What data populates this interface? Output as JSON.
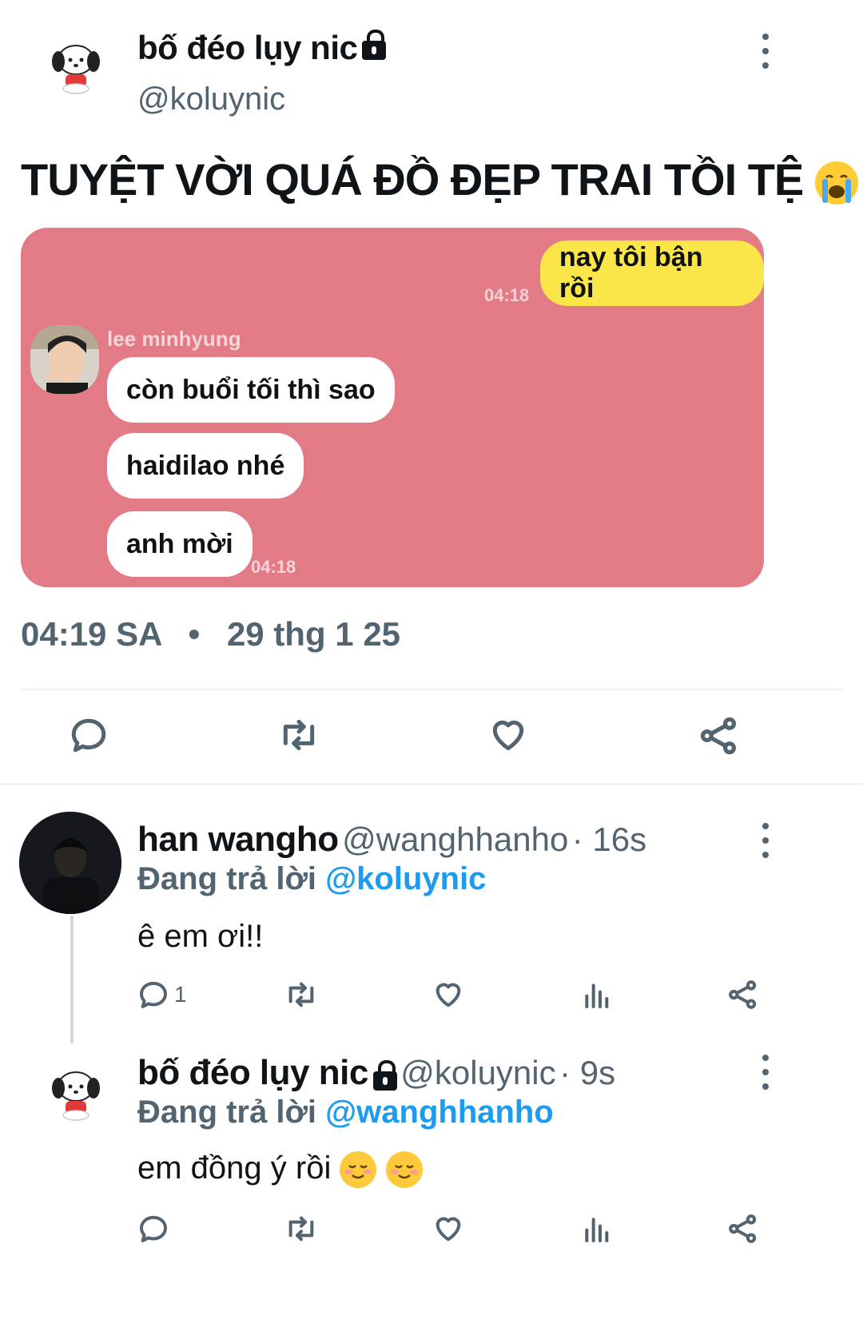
{
  "tweet": {
    "author_name": "bố đéo lụy nic",
    "author_handle": "@koluynic",
    "text": "TUYỆT VỜI QUÁ ĐỒ ĐẸP TRAI TỒI TỆ",
    "emoji": "loudly-crying-face",
    "time": "04:19 SA",
    "dot": "•",
    "date": "29 thg 1 25"
  },
  "chat": {
    "outgoing": {
      "text": "nay tôi bận rồi",
      "time": "04:18"
    },
    "sender_name": "lee minhyung",
    "incoming": [
      {
        "text": "còn buổi tối thì sao"
      },
      {
        "text": "haidilao nhé"
      },
      {
        "text": "anh mời"
      }
    ],
    "incoming_time": "04:18"
  },
  "colors": {
    "chat_bg": "#e27b85",
    "accent": "#1d9bf0",
    "muted": "#536471",
    "outgoing_bubble": "#fbe64a"
  },
  "replies": [
    {
      "name": "han wangho",
      "handle": "@wanghhanho",
      "age": "· 16s",
      "replying_prefix": "Đang trả lời",
      "replying_to": "@koluynic",
      "text": "ê em ơi!!",
      "reply_count": "1"
    },
    {
      "name": "bố đéo lụy nic",
      "handle": "@koluynic",
      "age": "· 9s",
      "replying_prefix": "Đang trả lời",
      "replying_to": "@wanghhanho",
      "text": "em đồng ý rồi",
      "emoji": "smiling-face"
    }
  ],
  "icons": [
    "more-icon",
    "reply-icon",
    "retweet-icon",
    "like-icon",
    "share-icon",
    "views-icon",
    "lock-icon"
  ]
}
